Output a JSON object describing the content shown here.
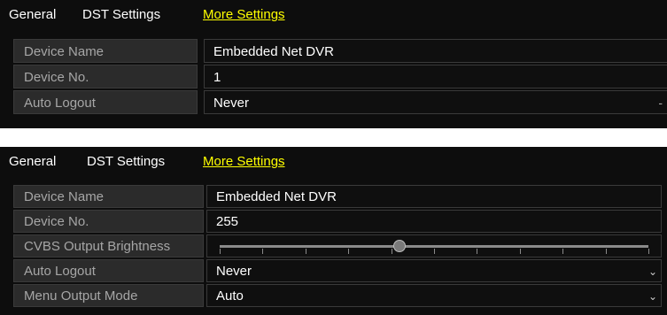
{
  "panel1": {
    "tabs": [
      {
        "label": "General",
        "active": false
      },
      {
        "label": "DST Settings",
        "active": false
      },
      {
        "label": "More Settings",
        "active": true
      }
    ],
    "rows": [
      {
        "label": "Device Name",
        "value": "Embedded Net DVR"
      },
      {
        "label": "Device No.",
        "value": "1"
      },
      {
        "label": "Auto Logout",
        "value": "Never"
      }
    ],
    "trailing_mark": "-"
  },
  "panel2": {
    "tabs": [
      {
        "label": "General",
        "active": false
      },
      {
        "label": "DST Settings",
        "active": false
      },
      {
        "label": "More Settings",
        "active": true
      }
    ],
    "rows": [
      {
        "label": "Device Name",
        "value": "Embedded Net DVR",
        "type": "text"
      },
      {
        "label": "Device No.",
        "value": "255",
        "type": "text"
      },
      {
        "label": "CVBS Output Brightness",
        "type": "slider",
        "level_fraction": 0.42,
        "tick_count": 11
      },
      {
        "label": "Auto Logout",
        "value": "Never",
        "type": "dropdown"
      },
      {
        "label": "Menu Output Mode",
        "value": "Auto",
        "type": "dropdown"
      }
    ],
    "dropdown_glyph": "⌄"
  },
  "colors": {
    "background": "#0d0d0d",
    "label_bg": "#2b2b2b",
    "active_tab": "#ffff00",
    "text": "#ffffff",
    "label_text": "#a6a6a6"
  }
}
